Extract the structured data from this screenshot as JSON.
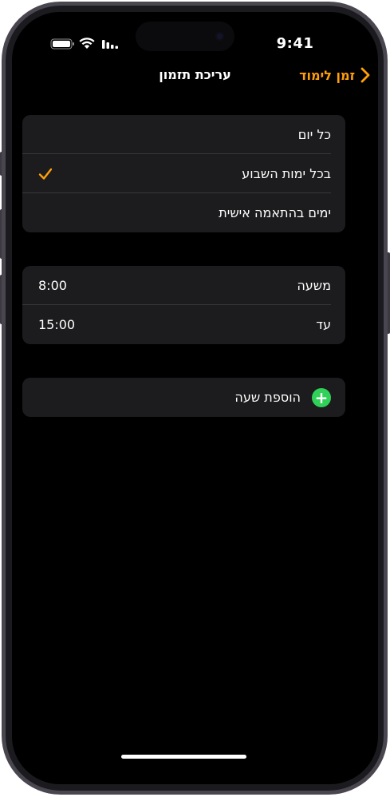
{
  "status_bar": {
    "time": "9:41"
  },
  "nav": {
    "title": "עריכת תזמון",
    "back_label": "זמן לימוד"
  },
  "frequency": {
    "options": [
      {
        "label": "כל יום",
        "selected": false
      },
      {
        "label": "בכל ימות השבוע",
        "selected": true
      },
      {
        "label": "ימים בהתאמה אישית",
        "selected": false
      }
    ]
  },
  "time_range": {
    "from": {
      "label": "משעה",
      "value": "8:00"
    },
    "to": {
      "label": "עד",
      "value": "15:00"
    }
  },
  "add_time": {
    "label": "הוספת שעה"
  },
  "colors": {
    "accent": "#ff9f0a",
    "add_green": "#30d158",
    "group_bg": "#1c1c1e"
  }
}
